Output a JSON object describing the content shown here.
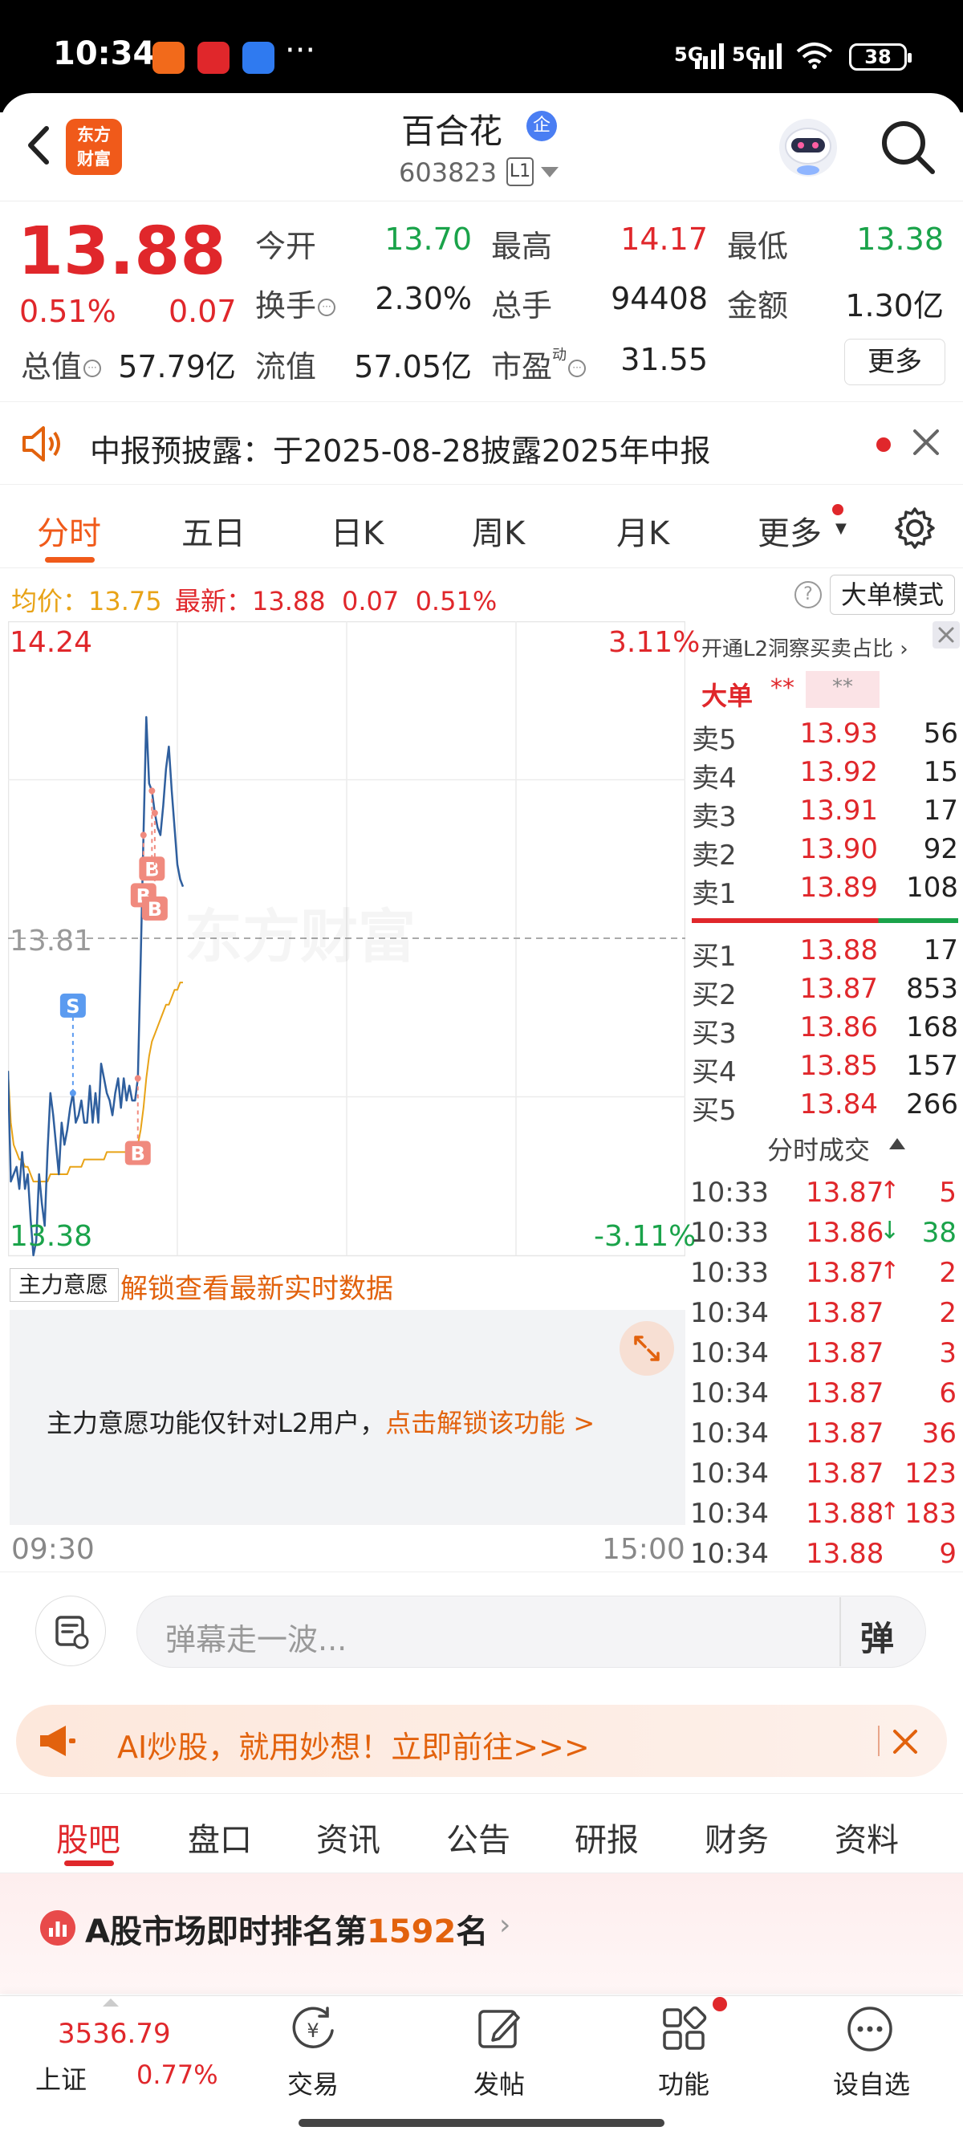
{
  "status_bar": {
    "time": "10:34",
    "dots": "···",
    "net1": "5G",
    "net2": "5G",
    "battery": "38"
  },
  "header": {
    "logo_line1": "东方",
    "logo_line2": "财富",
    "stock_name": "百合花",
    "enterprise_badge": "企",
    "stock_code": "603823",
    "level_badge": "L1"
  },
  "quote": {
    "price": "13.88",
    "change_pct": "0.51%",
    "change": "0.07",
    "open_label": "今开",
    "open": "13.70",
    "high_label": "最高",
    "high": "14.17",
    "low_label": "最低",
    "low": "13.38",
    "turnover_label": "换手",
    "turnover": "2.30%",
    "volume_label": "总手",
    "volume": "94408",
    "amount_label": "金额",
    "amount": "1.30亿",
    "mktcap_label": "总值",
    "mktcap": "57.79亿",
    "float_label": "流值",
    "float_cap": "57.05亿",
    "pe_label": "市盈",
    "pe_sup": "动",
    "pe": "31.55",
    "more_button": "更多"
  },
  "notice": {
    "text": "中报预披露：于2025-08-28披露2025年中报"
  },
  "chart_tabs": {
    "items": [
      "分时",
      "五日",
      "日K",
      "周K",
      "月K",
      "更多"
    ],
    "active": "分时"
  },
  "chart_info": {
    "avg_label": "均价：",
    "avg_value": "13.75",
    "last_label": "最新：",
    "last_value": "13.88",
    "last_change": "0.07",
    "last_pct": "0.51%",
    "help": "?",
    "bigorder_button": "大单模式"
  },
  "chart_data": {
    "type": "line",
    "title": "",
    "xlabel": "",
    "ylabel": "",
    "x_range": [
      "09:30",
      "15:00"
    ],
    "ylim": [
      13.38,
      14.24
    ],
    "y_right_labels": [
      "3.11%",
      "-3.11%"
    ],
    "prev_close": "13.81",
    "y_top_label": "14.24",
    "y_bottom_label": "13.38",
    "x_start_label": "09:30",
    "x_end_label": "15:00",
    "watermark": "东方财富",
    "grid": true,
    "series": [
      {
        "name": "",
        "color": "#2f5f9e",
        "values": [
          13.63,
          13.48,
          13.49,
          13.5,
          13.47,
          13.52,
          13.47,
          13.49,
          13.43,
          13.38,
          13.4,
          13.49,
          13.45,
          13.42,
          13.52,
          13.6,
          13.57,
          13.53,
          13.49,
          13.56,
          13.53,
          13.55,
          13.58,
          13.6,
          13.56,
          13.57,
          13.59,
          13.56,
          13.56,
          13.61,
          13.56,
          13.6,
          13.56,
          13.64,
          13.62,
          13.6,
          13.59,
          13.57,
          13.6,
          13.62,
          13.58,
          13.62,
          13.59,
          13.61,
          13.59,
          13.59,
          13.62,
          13.78,
          13.95,
          14.11,
          14.02,
          14.01,
          13.98,
          13.96,
          13.95,
          13.99,
          14.04,
          14.07,
          14.01,
          13.96,
          13.91,
          13.89,
          13.88
        ]
      },
      {
        "name": "",
        "color": "#e8a317",
        "values": [
          13.63,
          13.56,
          13.53,
          13.52,
          13.51,
          13.51,
          13.5,
          13.5,
          13.49,
          13.48,
          13.48,
          13.48,
          13.48,
          13.48,
          13.48,
          13.49,
          13.49,
          13.49,
          13.49,
          13.49,
          13.49,
          13.49,
          13.5,
          13.5,
          13.5,
          13.5,
          13.5,
          13.51,
          13.51,
          13.51,
          13.51,
          13.51,
          13.51,
          13.51,
          13.51,
          13.52,
          13.52,
          13.52,
          13.52,
          13.52,
          13.52,
          13.52,
          13.52,
          13.52,
          13.52,
          13.53,
          13.53,
          13.55,
          13.58,
          13.62,
          13.65,
          13.67,
          13.68,
          13.69,
          13.7,
          13.71,
          13.72,
          13.72,
          13.73,
          13.74,
          13.74,
          13.75,
          13.75
        ]
      }
    ],
    "markers": [
      {
        "label": "S",
        "index": 23,
        "color": "#5b9bf0"
      },
      {
        "label": "B",
        "index": 48,
        "color": "#f08a7e"
      },
      {
        "label": "B",
        "index": 51,
        "color": "#f08a7e"
      },
      {
        "label": "B",
        "index": 52,
        "color": "#f08a7e"
      },
      {
        "label": "B",
        "index": 46,
        "color": "#f08a7e"
      }
    ]
  },
  "orderbook": {
    "l2_link": "开通L2洞察买卖占比",
    "bigdeal_label": "大单",
    "bigdeal_stars": "**",
    "bigdeal_box": "**",
    "asks": [
      {
        "label": "卖5",
        "price": "13.93",
        "vol": "56"
      },
      {
        "label": "卖4",
        "price": "13.92",
        "vol": "15"
      },
      {
        "label": "卖3",
        "price": "13.91",
        "vol": "17"
      },
      {
        "label": "卖2",
        "price": "13.90",
        "vol": "92"
      },
      {
        "label": "卖1",
        "price": "13.89",
        "vol": "108"
      }
    ],
    "bids": [
      {
        "label": "买1",
        "price": "13.88",
        "vol": "17"
      },
      {
        "label": "买2",
        "price": "13.87",
        "vol": "853"
      },
      {
        "label": "买3",
        "price": "13.86",
        "vol": "168"
      },
      {
        "label": "买4",
        "price": "13.85",
        "vol": "157"
      },
      {
        "label": "买5",
        "price": "13.84",
        "vol": "266"
      }
    ],
    "trades_title": "分时成交",
    "trades": [
      {
        "time": "10:33",
        "price": "13.87",
        "arrow": "↑",
        "vol": "5",
        "dir": "up"
      },
      {
        "time": "10:33",
        "price": "13.86",
        "arrow": "↓",
        "vol": "38",
        "dir": "down"
      },
      {
        "time": "10:33",
        "price": "13.87",
        "arrow": "↑",
        "vol": "2",
        "dir": "up"
      },
      {
        "time": "10:34",
        "price": "13.87",
        "arrow": "",
        "vol": "2",
        "dir": "flat"
      },
      {
        "time": "10:34",
        "price": "13.87",
        "arrow": "",
        "vol": "3",
        "dir": "flat"
      },
      {
        "time": "10:34",
        "price": "13.87",
        "arrow": "",
        "vol": "6",
        "dir": "flat"
      },
      {
        "time": "10:34",
        "price": "13.87",
        "arrow": "",
        "vol": "36",
        "dir": "flat"
      },
      {
        "time": "10:34",
        "price": "13.87",
        "arrow": "",
        "vol": "123",
        "dir": "flat"
      },
      {
        "time": "10:34",
        "price": "13.88",
        "arrow": "↑",
        "vol": "183",
        "dir": "up"
      },
      {
        "time": "10:34",
        "price": "13.88",
        "arrow": "",
        "vol": "9",
        "dir": "flat"
      }
    ]
  },
  "main_force": {
    "select": "主力意愿",
    "unlock_link": "解锁查看最新实时数据",
    "text": "主力意愿功能仅针对L2用户，",
    "text_link": "点击解锁该功能 >"
  },
  "danmaku": {
    "placeholder": "弹幕走一波...",
    "button": "弹"
  },
  "ai_banner": {
    "text": "AI炒股，就用妙想！立即前往>>>"
  },
  "info_tabs": {
    "items": [
      "股吧",
      "盘口",
      "资讯",
      "公告",
      "研报",
      "财务",
      "资料"
    ],
    "active": "股吧"
  },
  "ranking": {
    "prefix": "A股市场即时排名第",
    "rank": "1592",
    "suffix": "名"
  },
  "bottom_nav": {
    "index_value": "3536.79",
    "index_name": "上证",
    "index_pct": "0.77%",
    "items": [
      "交易",
      "发帖",
      "功能",
      "设自选"
    ]
  }
}
